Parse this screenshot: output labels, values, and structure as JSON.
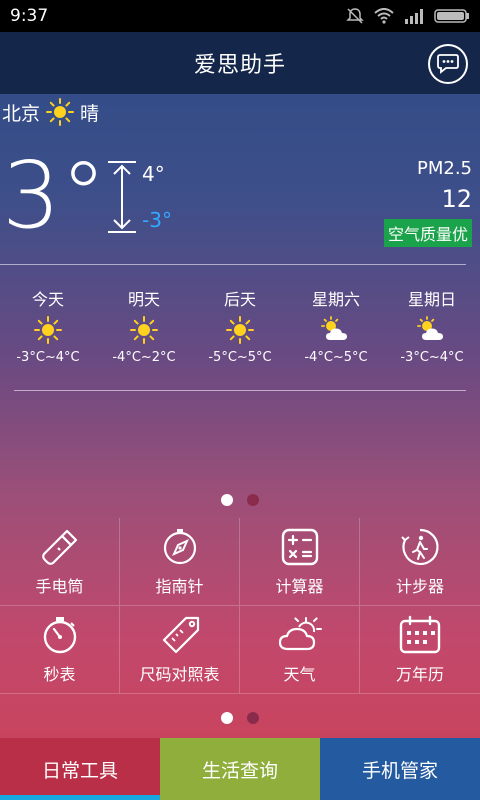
{
  "status": {
    "time": "9:37"
  },
  "header": {
    "title": "爱思助手"
  },
  "weather": {
    "city": "北京",
    "condition": "晴",
    "temp": "3°",
    "high": "4°",
    "low": "-3°",
    "pm_label": "PM2.5",
    "pm_value": "12",
    "air_quality": "空气质量优"
  },
  "forecast": [
    {
      "day": "今天",
      "icon": "sun-icon",
      "range": "-3°C~4°C"
    },
    {
      "day": "明天",
      "icon": "sun-icon",
      "range": "-4°C~2°C"
    },
    {
      "day": "后天",
      "icon": "sun-icon",
      "range": "-5°C~5°C"
    },
    {
      "day": "星期六",
      "icon": "partly-cloudy-icon",
      "range": "-4°C~5°C"
    },
    {
      "day": "星期日",
      "icon": "partly-cloudy-icon",
      "range": "-3°C~4°C"
    }
  ],
  "tools": [
    {
      "label": "手电筒",
      "icon": "flashlight-icon"
    },
    {
      "label": "指南针",
      "icon": "compass-icon"
    },
    {
      "label": "计算器",
      "icon": "calculator-icon"
    },
    {
      "label": "计步器",
      "icon": "pedometer-icon"
    },
    {
      "label": "秒表",
      "icon": "stopwatch-icon"
    },
    {
      "label": "尺码对照表",
      "icon": "size-tag-icon"
    },
    {
      "label": "天气",
      "icon": "weather-icon"
    },
    {
      "label": "万年历",
      "icon": "calendar-icon"
    }
  ],
  "tabs": [
    {
      "label": "日常工具"
    },
    {
      "label": "生活查询"
    },
    {
      "label": "手机管家"
    }
  ],
  "colors": {
    "title_bar": "#14264a",
    "aq_badge": "#1aa34a",
    "low_temp": "#35a8ff",
    "tab_active": "#b92f48",
    "tab_life": "#8fae3b",
    "tab_phone": "#235aa0"
  }
}
